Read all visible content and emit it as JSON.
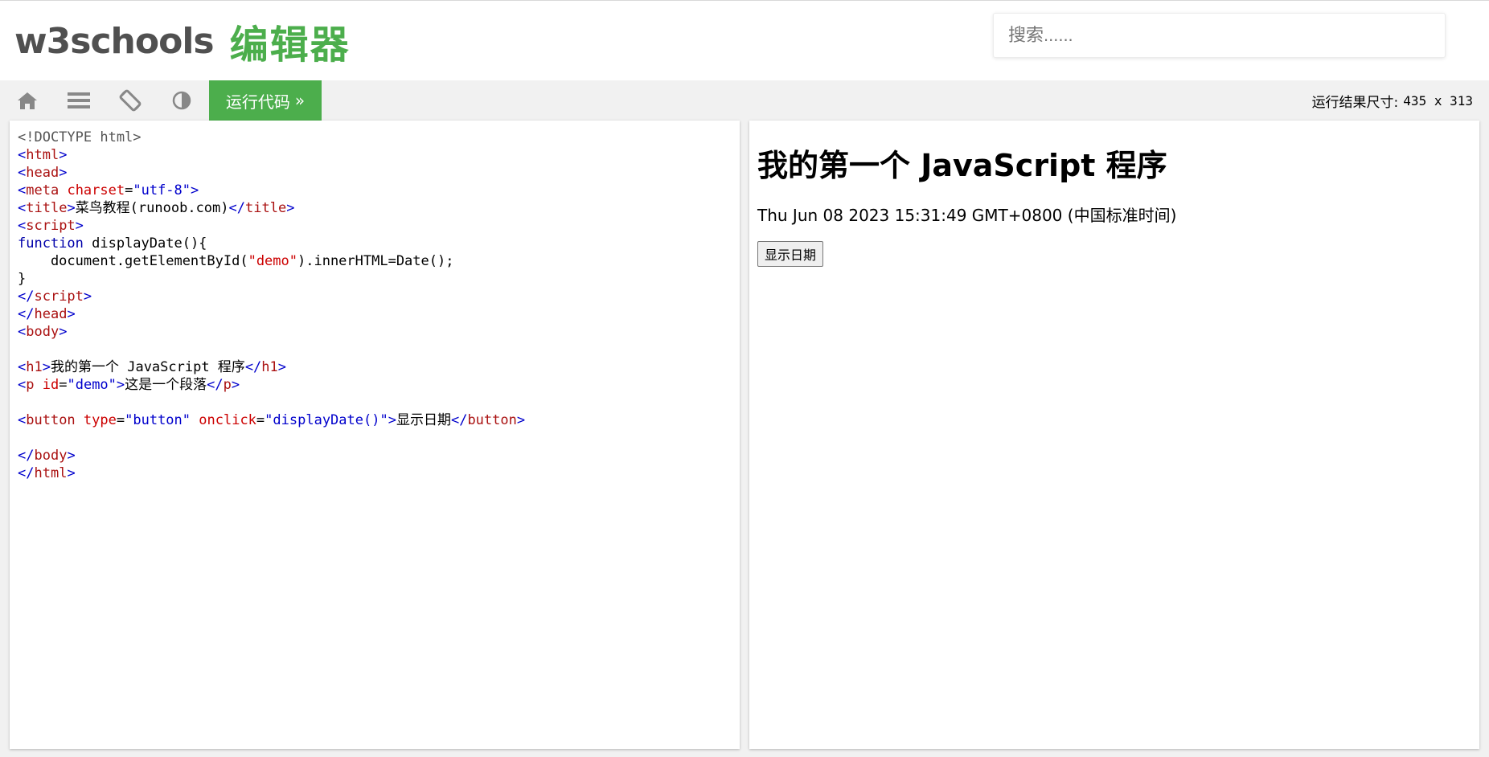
{
  "header": {
    "brand": "w3schools",
    "title_cn": "编辑器",
    "search_placeholder": "搜索......"
  },
  "toolbar": {
    "icons": [
      "home-icon",
      "menu-icon",
      "rotate-icon",
      "contrast-icon"
    ],
    "run_label": "运行代码",
    "run_icon": "»",
    "result_size_label": "运行结果尺寸:",
    "result_size_value": "435 x 313"
  },
  "colors": {
    "accent": "#4cae4c",
    "toolbar_bg": "#f1f1f1",
    "icon": "#888888"
  },
  "editor": {
    "lines": [
      [
        {
          "c": "meta",
          "t": "<!DOCTYPE html>"
        }
      ],
      [
        {
          "c": "tag",
          "t": "<"
        },
        {
          "c": "tagn",
          "t": "html"
        },
        {
          "c": "tag",
          "t": ">"
        }
      ],
      [
        {
          "c": "tag",
          "t": "<"
        },
        {
          "c": "tagn",
          "t": "head"
        },
        {
          "c": "tag",
          "t": ">"
        }
      ],
      [
        {
          "c": "tag",
          "t": "<"
        },
        {
          "c": "tagn",
          "t": "meta"
        },
        {
          "c": "",
          "t": " "
        },
        {
          "c": "attr",
          "t": "charset"
        },
        {
          "c": "",
          "t": "="
        },
        {
          "c": "str",
          "t": "\"utf-8\""
        },
        {
          "c": "tag",
          "t": ">"
        }
      ],
      [
        {
          "c": "tag",
          "t": "<"
        },
        {
          "c": "tagn",
          "t": "title"
        },
        {
          "c": "tag",
          "t": ">"
        },
        {
          "c": "",
          "t": "菜鸟教程(runoob.com)"
        },
        {
          "c": "tag",
          "t": "</"
        },
        {
          "c": "tagn",
          "t": "title"
        },
        {
          "c": "tag",
          "t": ">"
        }
      ],
      [
        {
          "c": "tag",
          "t": "<"
        },
        {
          "c": "tagn",
          "t": "script"
        },
        {
          "c": "tag",
          "t": ">"
        }
      ],
      [
        {
          "c": "kw",
          "t": "function"
        },
        {
          "c": "",
          "t": " displayDate(){"
        }
      ],
      [
        {
          "c": "",
          "t": "    document.getElementById("
        },
        {
          "c": "attr",
          "t": "\"demo\""
        },
        {
          "c": "",
          "t": ").innerHTML=Date();"
        }
      ],
      [
        {
          "c": "",
          "t": "}"
        }
      ],
      [
        {
          "c": "tag",
          "t": "</"
        },
        {
          "c": "tagn",
          "t": "script"
        },
        {
          "c": "tag",
          "t": ">"
        }
      ],
      [
        {
          "c": "tag",
          "t": "</"
        },
        {
          "c": "tagn",
          "t": "head"
        },
        {
          "c": "tag",
          "t": ">"
        }
      ],
      [
        {
          "c": "tag",
          "t": "<"
        },
        {
          "c": "tagn",
          "t": "body"
        },
        {
          "c": "tag",
          "t": ">"
        }
      ],
      [],
      [
        {
          "c": "tag",
          "t": "<"
        },
        {
          "c": "tagn",
          "t": "h1"
        },
        {
          "c": "tag",
          "t": ">"
        },
        {
          "c": "",
          "t": "我的第一个 JavaScript 程序"
        },
        {
          "c": "tag",
          "t": "</"
        },
        {
          "c": "tagn",
          "t": "h1"
        },
        {
          "c": "tag",
          "t": ">"
        }
      ],
      [
        {
          "c": "tag",
          "t": "<"
        },
        {
          "c": "tagn",
          "t": "p"
        },
        {
          "c": "",
          "t": " "
        },
        {
          "c": "attr",
          "t": "id"
        },
        {
          "c": "",
          "t": "="
        },
        {
          "c": "str",
          "t": "\"demo\""
        },
        {
          "c": "tag",
          "t": ">"
        },
        {
          "c": "",
          "t": "这是一个段落"
        },
        {
          "c": "tag",
          "t": "</"
        },
        {
          "c": "tagn",
          "t": "p"
        },
        {
          "c": "tag",
          "t": ">"
        }
      ],
      [],
      [
        {
          "c": "tag",
          "t": "<"
        },
        {
          "c": "tagn",
          "t": "button"
        },
        {
          "c": "",
          "t": " "
        },
        {
          "c": "attr",
          "t": "type"
        },
        {
          "c": "",
          "t": "="
        },
        {
          "c": "str",
          "t": "\"button\""
        },
        {
          "c": "",
          "t": " "
        },
        {
          "c": "attr",
          "t": "onclick"
        },
        {
          "c": "",
          "t": "="
        },
        {
          "c": "str",
          "t": "\"displayDate()\""
        },
        {
          "c": "tag",
          "t": ">"
        },
        {
          "c": "",
          "t": "显示日期"
        },
        {
          "c": "tag",
          "t": "</"
        },
        {
          "c": "tagn",
          "t": "button"
        },
        {
          "c": "tag",
          "t": ">"
        }
      ],
      [],
      [
        {
          "c": "tag",
          "t": "</"
        },
        {
          "c": "tagn",
          "t": "body"
        },
        {
          "c": "tag",
          "t": ">"
        }
      ],
      [
        {
          "c": "tag",
          "t": "</"
        },
        {
          "c": "tagn",
          "t": "html"
        },
        {
          "c": "tag",
          "t": ">"
        }
      ]
    ]
  },
  "preview": {
    "heading": "我的第一个 JavaScript 程序",
    "paragraph": "Thu Jun 08 2023 15:31:49 GMT+0800 (中国标准时间)",
    "button_label": "显示日期"
  }
}
